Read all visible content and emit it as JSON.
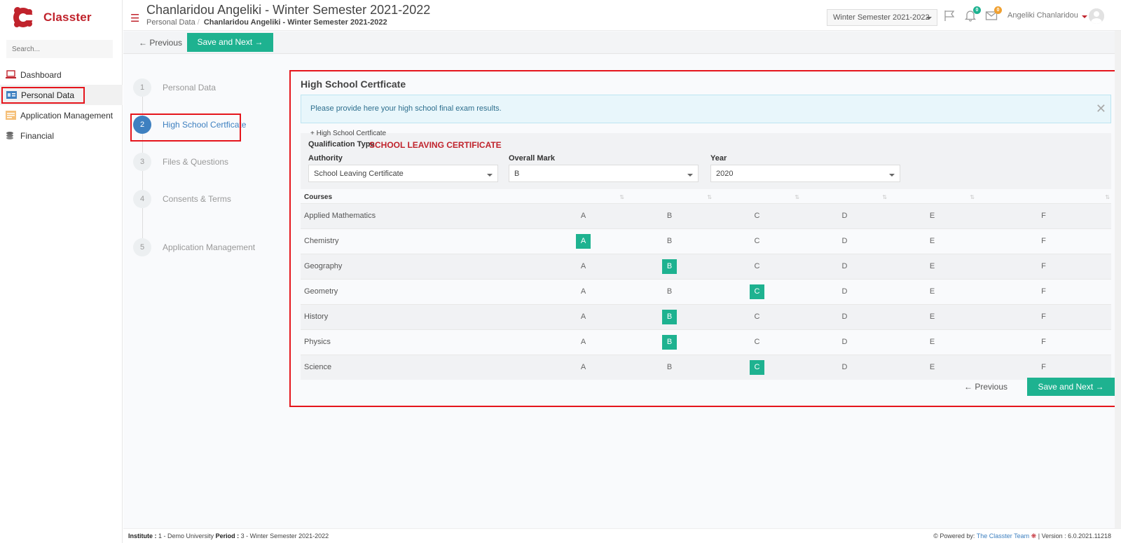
{
  "app": {
    "name": "Classter"
  },
  "sidebar": {
    "search_placeholder": "Search...",
    "items": [
      {
        "label": "Dashboard",
        "icon": "laptop-icon"
      },
      {
        "label": "Personal Data",
        "icon": "id-card-icon"
      },
      {
        "label": "Application Management",
        "icon": "form-icon"
      },
      {
        "label": "Financial",
        "icon": "coins-icon"
      }
    ]
  },
  "header": {
    "title": "Chanlaridou Angeliki - Winter Semester 2021-2022",
    "breadcrumb": [
      "Personal Data",
      "Chanlaridou Angeliki - Winter Semester 2021-2022"
    ],
    "semester": "Winter Semester 2021-2022",
    "notifications_count": "0",
    "messages_count": "0",
    "user": "Angeliki Chanlaridou"
  },
  "toolbar": {
    "previous": "← Previous",
    "save_next": "Save and Next →"
  },
  "steps": [
    {
      "num": "1",
      "label": "Personal Data"
    },
    {
      "num": "2",
      "label": "High School Certficate"
    },
    {
      "num": "3",
      "label": "Files & Questions"
    },
    {
      "num": "4",
      "label": "Consents & Terms"
    },
    {
      "num": "5",
      "label": "Application Management"
    }
  ],
  "panel": {
    "title": "High School Certficate",
    "alert": "Please provide here your high school final exam results.",
    "add_link": "+ High School Certficate",
    "qualification_type_label": "Qualification Type",
    "qualification_type_value": "SCHOOL LEAVING CERTIFICATE",
    "authority_label": "Authority",
    "authority_value": "School Leaving Certificate",
    "overall_mark_label": "Overall Mark",
    "overall_mark_value": "B",
    "year_label": "Year",
    "year_value": "2020",
    "table": {
      "header": "Courses",
      "grades": [
        "A",
        "B",
        "C",
        "D",
        "E",
        "F"
      ],
      "rows": [
        {
          "course": "Applied Mathematics",
          "selected": ""
        },
        {
          "course": "Chemistry",
          "selected": "A"
        },
        {
          "course": "Geography",
          "selected": "B"
        },
        {
          "course": "Geometry",
          "selected": "C"
        },
        {
          "course": "History",
          "selected": "B"
        },
        {
          "course": "Physics",
          "selected": "B"
        },
        {
          "course": "Science",
          "selected": "C"
        }
      ]
    },
    "previous": "← Previous",
    "save_next": "Save and Next →"
  },
  "footer": {
    "institute_label": "Institute :",
    "institute_value": "1 - Demo University",
    "period_label": "Period :",
    "period_value": "3 - Winter Semester 2021-2022",
    "powered_by": "Powered by:",
    "team": "The Classter Team",
    "version": "| Version : 6.0.2021.11218"
  },
  "colors": {
    "accent": "#1eb290",
    "brand": "#c0232c",
    "highlight": "#e5151c",
    "step_active": "#3e80c0"
  }
}
